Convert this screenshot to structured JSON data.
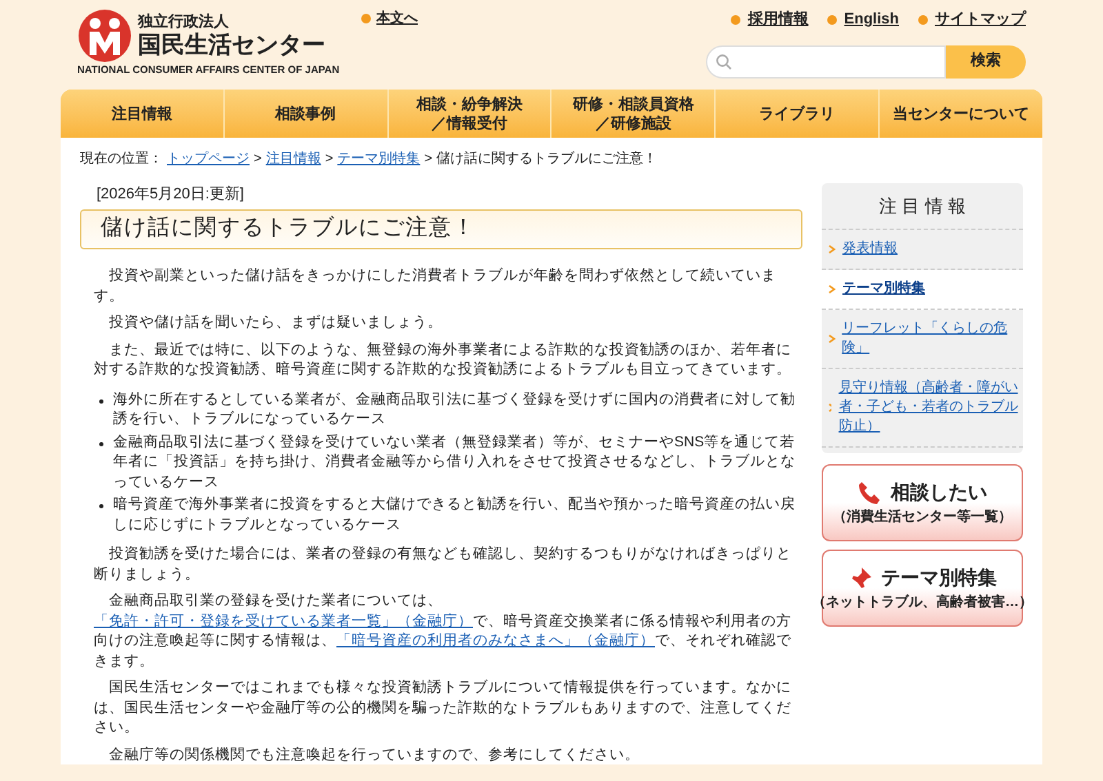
{
  "header": {
    "logo": {
      "org_type": "独立行政法人",
      "name": "国民生活センター",
      "english": "NATIONAL CONSUMER AFFAIRS CENTER OF JAPAN"
    },
    "skip_link": "本文へ",
    "top_links": [
      "採用情報",
      "English",
      "サイトマップ"
    ],
    "search": {
      "button": "検索"
    }
  },
  "nav": [
    {
      "lines": [
        "注目情報"
      ]
    },
    {
      "lines": [
        "相談事例"
      ]
    },
    {
      "lines": [
        "相談・紛争解決",
        "／情報受付"
      ]
    },
    {
      "lines": [
        "研修・相談員資格",
        "／研修施設"
      ]
    },
    {
      "lines": [
        "ライブラリ"
      ]
    },
    {
      "lines": [
        "当センターについて"
      ]
    }
  ],
  "breadcrumb": {
    "label": "現在の位置：",
    "links": [
      "トップページ",
      "注目情報",
      "テーマ別特集"
    ],
    "separator": ">",
    "current": "儲け話に関するトラブルにご注意！"
  },
  "updated": "[2026年5月20日:更新]",
  "heading": "儲け話に関するトラブルにご注意！",
  "body": [
    {
      "kind": "paragraph",
      "text": "投資や副業といった儲け話をきっかけにした消費者トラブルが年齢を問わず依然として続いています。"
    },
    {
      "kind": "paragraph",
      "text": "投資や儲け話を聞いたら、まずは疑いましょう。"
    },
    {
      "kind": "paragraph",
      "text": "また、最近では特に、以下のような、無登録の海外事業者による詐欺的な投資勧誘のほか、若年者に対する詐欺的な投資勧誘、暗号資産に関する詐欺的な投資勧誘によるトラブルも目立ってきています。"
    },
    {
      "kind": "list",
      "items": [
        "海外に所在するとしている業者が、金融商品取引法に基づく登録を受けずに国内の消費者に対して勧誘を行い、トラブルになっているケース",
        "金融商品取引法に基づく登録を受けていない業者（無登録業者）等が、セミナーやSNS等を通じて若年者に「投資話」を持ち掛け、消費者金融等から借り入れをさせて投資させるなどし、トラブルとなっているケース",
        "暗号資産で海外事業者に投資をすると大儲けできると勧誘を行い、配当や預かった暗号資産の払い戻しに応じずにトラブルとなっているケース"
      ]
    },
    {
      "kind": "paragraph",
      "text": "投資勧誘を受けた場合には、業者の登録の有無なども確認し、契約するつもりがなければきっぱりと断りましょう。"
    },
    {
      "kind": "paragraph",
      "segments": [
        {
          "kind": "text",
          "text": "金融商品取引業の登録を受けた業者については、"
        },
        {
          "kind": "link",
          "text": "「免許・許可・登録を受けている業者一覧」（金融庁）"
        },
        {
          "kind": "text",
          "text": "で、暗号資産交換業者に係る情報や利用者の方向けの注意喚起等に関する情報は、"
        },
        {
          "kind": "link",
          "text": "「暗号資産の利用者のみなさまへ」（金融庁）"
        },
        {
          "kind": "text",
          "text": "で、それぞれ確認できます。"
        }
      ]
    },
    {
      "kind": "paragraph",
      "text": "国民生活センターではこれまでも様々な投資勧誘トラブルについて情報提供を行っています。なかには、国民生活センターや金融庁等の公的機関を騙った詐欺的なトラブルもありますので、注意してください。"
    },
    {
      "kind": "paragraph",
      "text": "金融庁等の関係機関でも注意喚起を行っていますので、参考にしてください。"
    }
  ],
  "sidebar": {
    "title": "注 目 情 報",
    "items": [
      {
        "label": "発表情報",
        "selected": false
      },
      {
        "label": "テーマ別特集",
        "selected": true
      },
      {
        "label": "リーフレット「くらしの危険」",
        "selected": false
      },
      {
        "label": "見守り情報（高齢者・障がい者・子ども・若者のトラブル防止）",
        "selected": false
      }
    ],
    "banners": [
      {
        "kind": "phone",
        "title": "相談したい",
        "subtitle": "（消費生活センター等一覧）"
      },
      {
        "kind": "pin",
        "title": "テーマ別特集",
        "subtitle": "（ネットトラブル、高齢者被害…）"
      }
    ]
  }
}
